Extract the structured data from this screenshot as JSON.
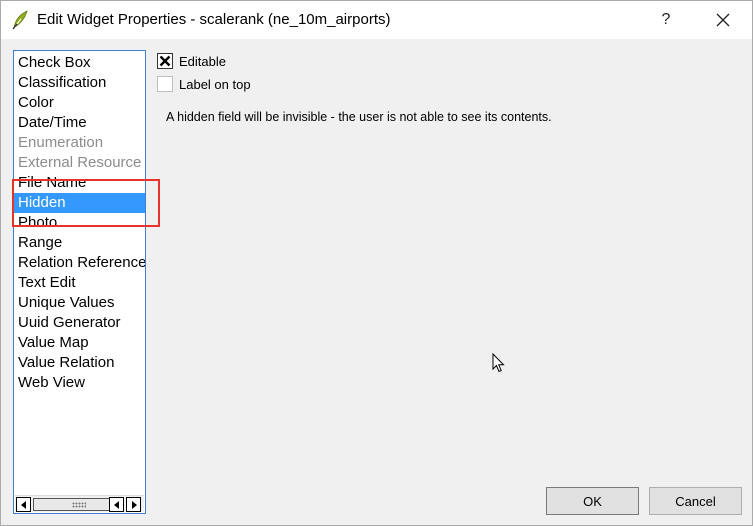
{
  "window": {
    "title": "Edit Widget Properties - scalerank (ne_10m_airports)",
    "help_label": "?"
  },
  "type_list": {
    "items": [
      {
        "label": "Check Box",
        "state": "normal"
      },
      {
        "label": "Classification",
        "state": "normal"
      },
      {
        "label": "Color",
        "state": "normal"
      },
      {
        "label": "Date/Time",
        "state": "normal"
      },
      {
        "label": "Enumeration",
        "state": "disabled"
      },
      {
        "label": "External Resource",
        "state": "disabled"
      },
      {
        "label": "File Name",
        "state": "normal"
      },
      {
        "label": "Hidden",
        "state": "selected"
      },
      {
        "label": "Photo",
        "state": "normal"
      },
      {
        "label": "Range",
        "state": "normal"
      },
      {
        "label": "Relation Reference",
        "state": "normal"
      },
      {
        "label": "Text Edit",
        "state": "normal"
      },
      {
        "label": "Unique Values",
        "state": "normal"
      },
      {
        "label": "Uuid Generator",
        "state": "normal"
      },
      {
        "label": "Value Map",
        "state": "normal"
      },
      {
        "label": "Value Relation",
        "state": "normal"
      },
      {
        "label": "Web View",
        "state": "normal"
      }
    ]
  },
  "options": {
    "editable": {
      "label": "Editable",
      "checked": true
    },
    "label_on_top": {
      "label": "Label on top",
      "checked": false
    }
  },
  "description": "A hidden field will be invisible - the user is not able to see its contents.",
  "buttons": {
    "ok": "OK",
    "cancel": "Cancel"
  },
  "colors": {
    "selection": "#3399ff",
    "highlight_box": "#e8322a",
    "list_border": "#3c7fd4"
  },
  "icons": {
    "app": "qgis-icon",
    "close": "close-icon",
    "cursor": "mouse-pointer-icon"
  }
}
